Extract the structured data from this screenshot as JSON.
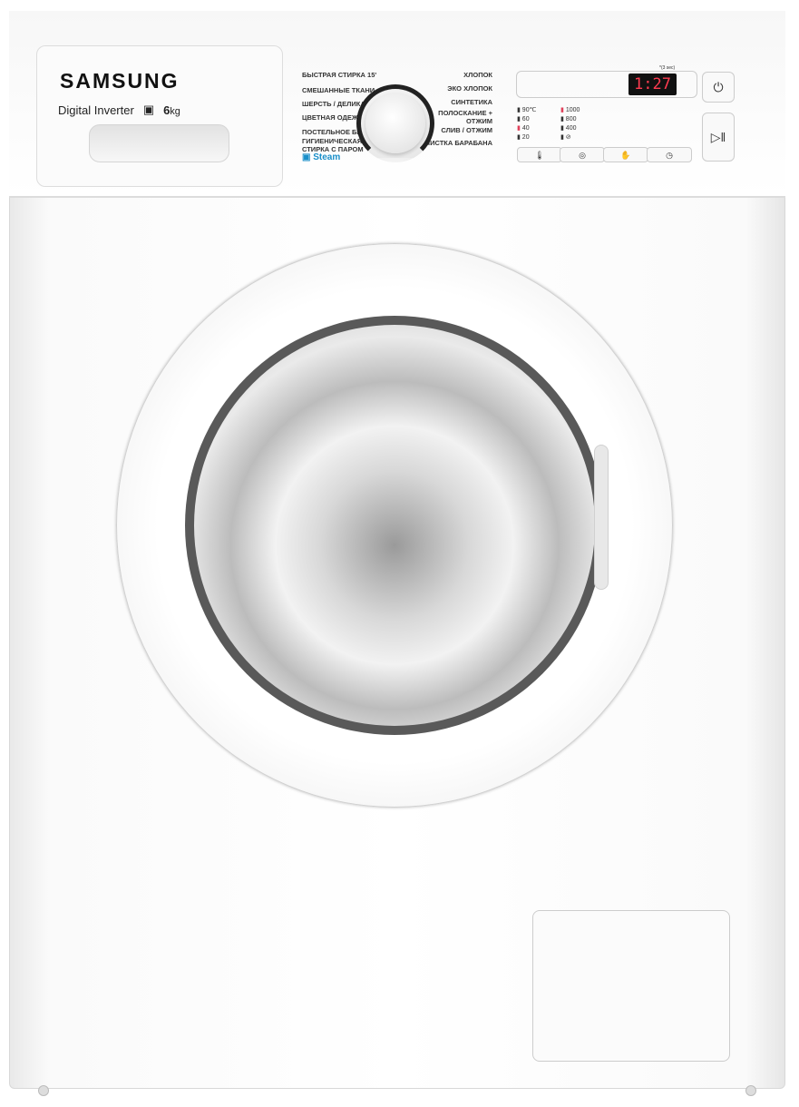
{
  "brand": "SAMSUNG",
  "model_line": "Digital Inverter",
  "capacity": "6",
  "capacity_unit": "kg",
  "programs_left": [
    "БЫСТРАЯ СТИРКА 15'",
    "СМЕШАННЫЕ ТКАНИ",
    "ШЕРСТЬ / ДЕЛИКАТ.",
    "ЦВЕТНАЯ ОДЕЖДА",
    "ПОСТЕЛЬНОЕ БЕЛЬЕ",
    "ГИГИЕНИЧЕСКАЯ СТИРКА С ПАРОМ"
  ],
  "programs_right": [
    "ХЛОПОК",
    "ЭКО ХЛОПОК",
    "СИНТЕТИКА",
    "ПОЛОСКАНИЕ + ОТЖИМ",
    "СЛИВ / ОТЖИМ",
    "ОЧИСТКА БАРАБАНА"
  ],
  "steam_label": "Steam",
  "display_time": "1:27",
  "hold_note": "*(3 sec)",
  "temperatures": [
    "90℃",
    "60",
    "40",
    "20"
  ],
  "selected_temperature": "40",
  "spin_speeds": [
    "1000",
    "800",
    "400",
    "⊘"
  ],
  "selected_spin": "1000",
  "buttons": {
    "temp": "🌡",
    "spin": "◎",
    "options": "✋",
    "delay": "◷",
    "power": "⏻",
    "start_pause": "▷‖"
  },
  "colors": {
    "display_digits": "#ff3b50",
    "steam": "#1a8fc9",
    "indicator_selected": "#e0405a"
  }
}
